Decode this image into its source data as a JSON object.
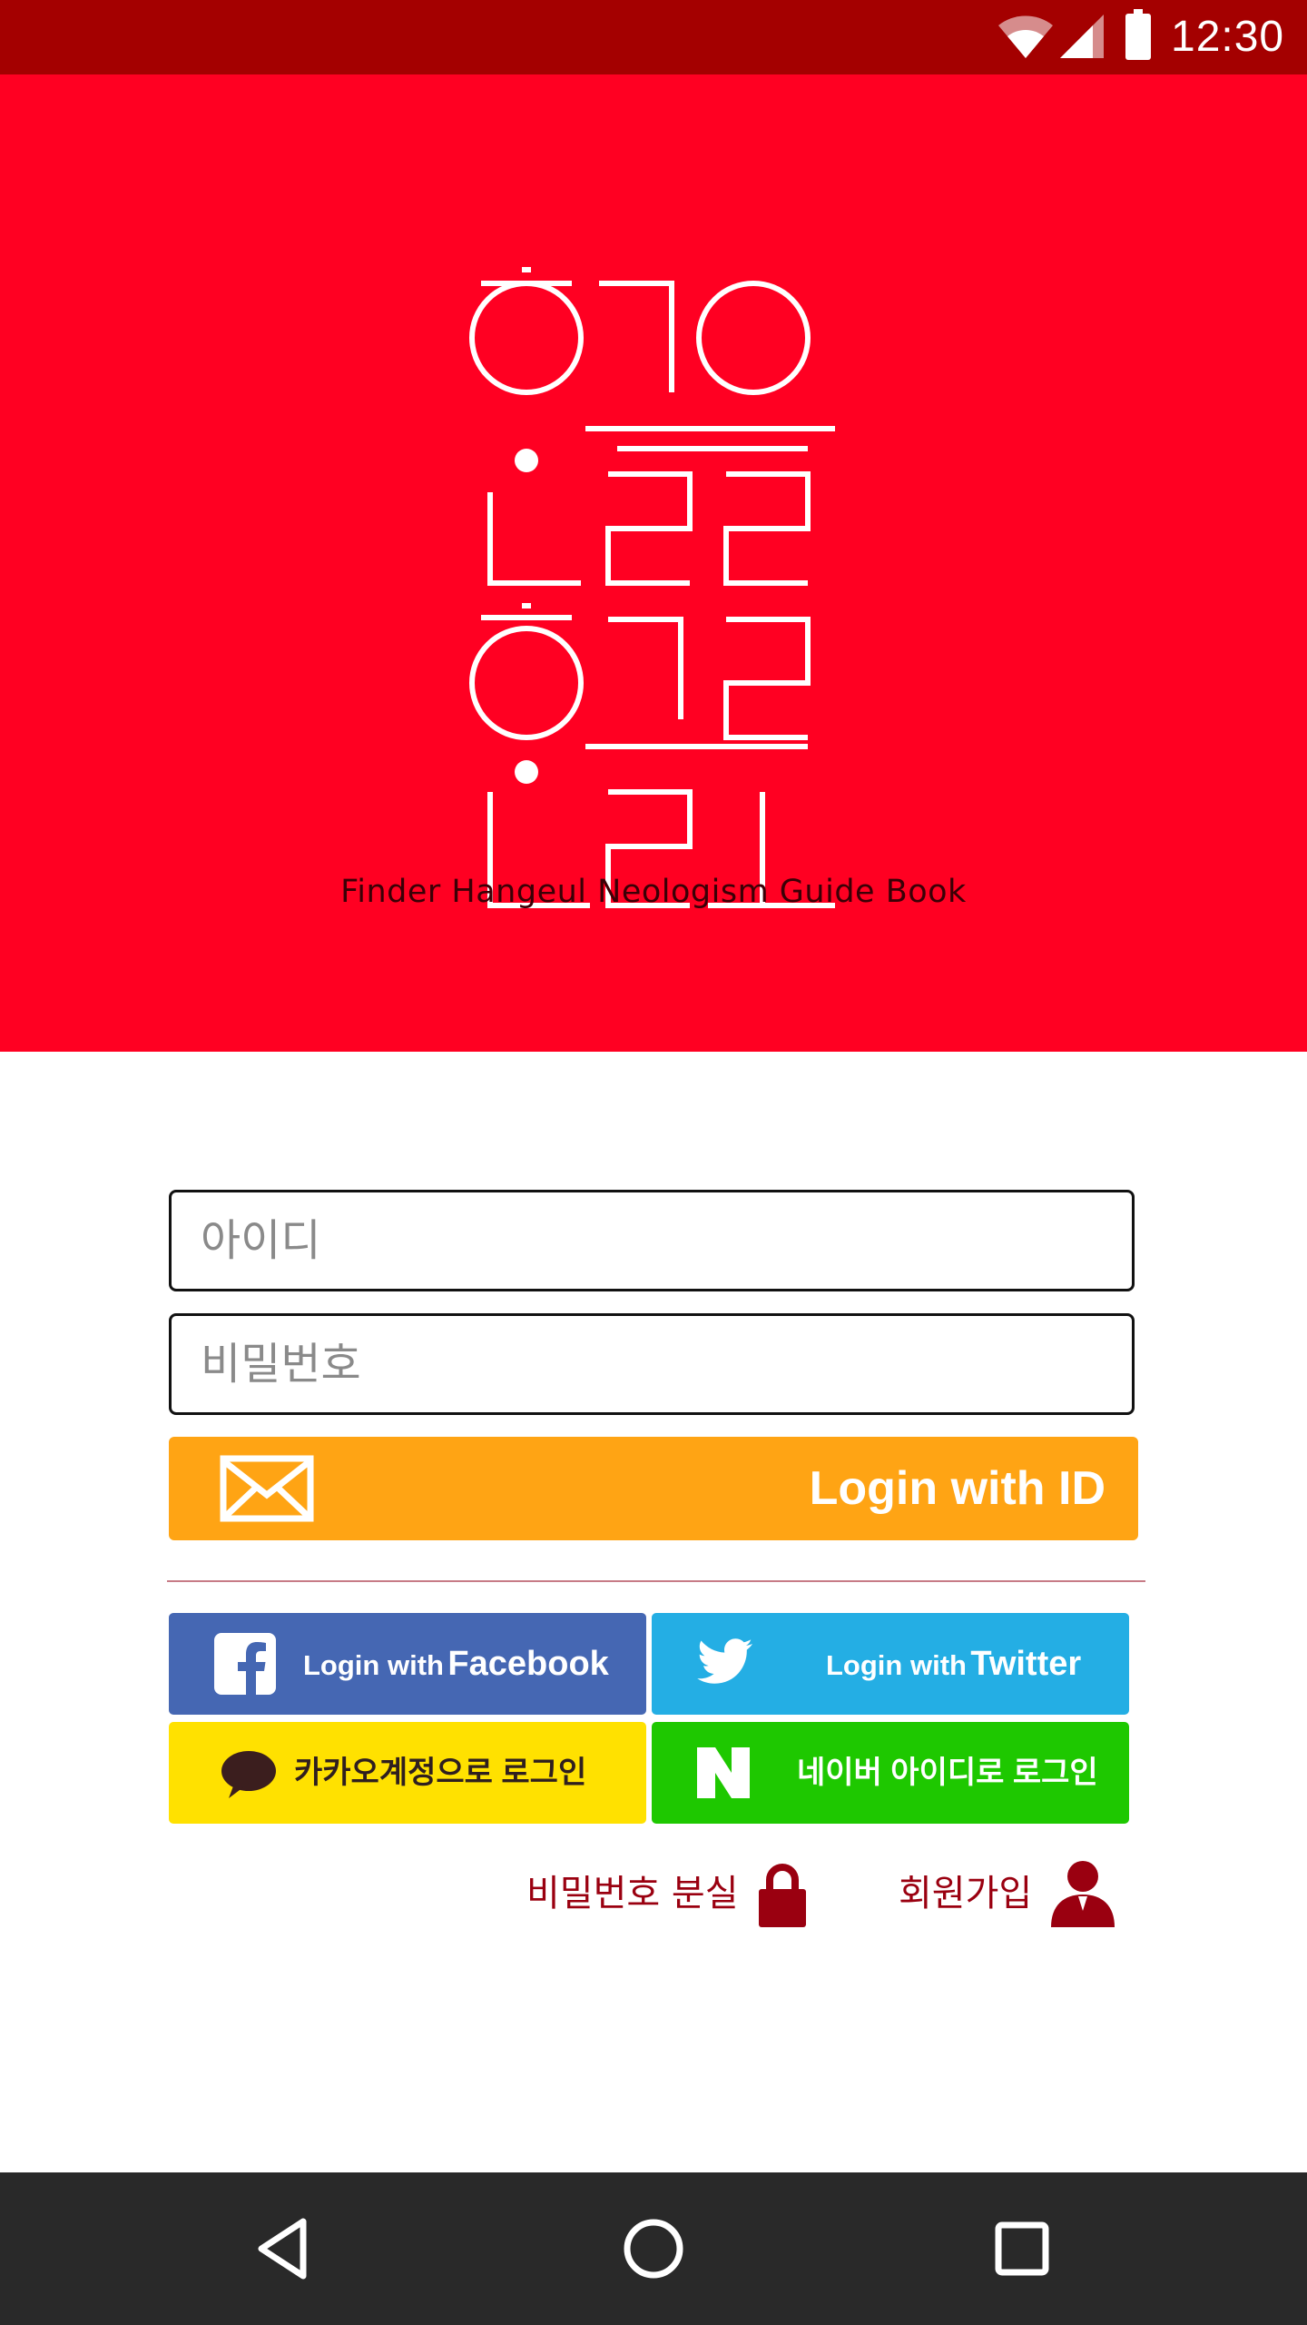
{
  "status_bar": {
    "time": "12:30",
    "icons": [
      "wifi-icon",
      "cell-signal-icon",
      "battery-icon"
    ]
  },
  "header": {
    "logo_text": "찾아줘 신조어 가이드북 로고",
    "tagline": "Finder Hangeul Neologism Guide Book",
    "background_color": "#FF0022"
  },
  "form": {
    "id_placeholder": "아이디",
    "id_value": "",
    "password_placeholder": "비밀번호",
    "password_value": "",
    "login_id_button": "Login with ID"
  },
  "social": {
    "facebook": {
      "prefix": "Login with",
      "brand": "Facebook",
      "color": "#4567B3"
    },
    "twitter": {
      "prefix": "Login with",
      "brand": "Twitter",
      "color": "#24AEE4"
    },
    "kakao": {
      "label": "카카오계정으로 로그인",
      "color": "#FFE100"
    },
    "naver": {
      "label": "네이버 아이디로 로그인",
      "color": "#1EC800"
    }
  },
  "links": {
    "forgot_password": "비밀번호 분실",
    "sign_up": "회원가입"
  },
  "nav_bar": {
    "icons": [
      "back-icon",
      "home-icon",
      "recent-apps-icon"
    ]
  },
  "colors": {
    "status_bar": "#A40000",
    "accent_orange": "#FFA414",
    "link_red": "#9A0010"
  }
}
